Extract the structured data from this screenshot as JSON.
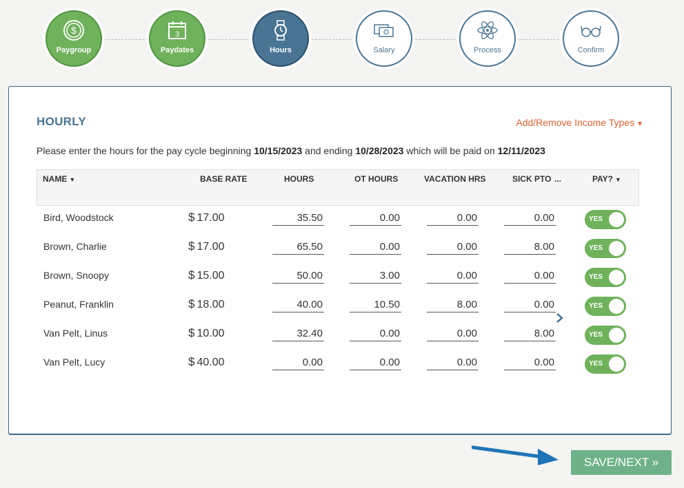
{
  "stepper": {
    "steps": [
      {
        "label": "Paygroup",
        "state": "done",
        "icon": "dollar-coin-icon"
      },
      {
        "label": "Paydates",
        "state": "done",
        "icon": "calendar-icon"
      },
      {
        "label": "Hours",
        "state": "active",
        "icon": "watch-icon"
      },
      {
        "label": "Salary",
        "state": "todo",
        "icon": "money-bill-icon"
      },
      {
        "label": "Process",
        "state": "todo",
        "icon": "atom-icon"
      },
      {
        "label": "Confirm",
        "state": "todo",
        "icon": "eyeglasses-icon"
      }
    ]
  },
  "section": {
    "title": "HOURLY",
    "income_types_label": "Add/Remove Income Types"
  },
  "intro": {
    "prefix": "Please enter the hours for the pay cycle beginning",
    "start_date": "10/15/2023",
    "mid": "and ending",
    "end_date": "10/28/2023",
    "suffix": "which will be paid on",
    "pay_date": "12/11/2023"
  },
  "table": {
    "headers": {
      "name": "NAME",
      "base_rate": "BASE RATE",
      "hours": "HOURS",
      "ot_hours": "OT HOURS",
      "vacation": "VACATION HRS",
      "sick": "SICK PTO",
      "more": "...",
      "pay": "PAY?"
    },
    "rows": [
      {
        "name": "Bird, Woodstock",
        "rate": "17.00",
        "hours": "35.50",
        "ot": "0.00",
        "vacation": "0.00",
        "sick": "0.00",
        "pay": "YES"
      },
      {
        "name": "Brown, Charlie",
        "rate": "17.00",
        "hours": "65.50",
        "ot": "0.00",
        "vacation": "0.00",
        "sick": "8.00",
        "pay": "YES"
      },
      {
        "name": "Brown, Snoopy",
        "rate": "15.00",
        "hours": "50.00",
        "ot": "3.00",
        "vacation": "0.00",
        "sick": "0.00",
        "pay": "YES"
      },
      {
        "name": "Peanut, Franklin",
        "rate": "18.00",
        "hours": "40.00",
        "ot": "10.50",
        "vacation": "8.00",
        "sick": "0.00",
        "pay": "YES"
      },
      {
        "name": "Van Pelt, Linus",
        "rate": "10.00",
        "hours": "32.40",
        "ot": "0.00",
        "vacation": "0.00",
        "sick": "8.00",
        "pay": "YES"
      },
      {
        "name": "Van Pelt, Lucy",
        "rate": "40.00",
        "hours": "0.00",
        "ot": "0.00",
        "vacation": "0.00",
        "sick": "0.00",
        "pay": "YES"
      }
    ],
    "currency_symbol": "$"
  },
  "footer": {
    "save_label": "SAVE/NEXT »"
  },
  "colors": {
    "done": "#6fb25b",
    "active": "#4a7494",
    "accent": "#e06030",
    "save": "#6fb289"
  }
}
